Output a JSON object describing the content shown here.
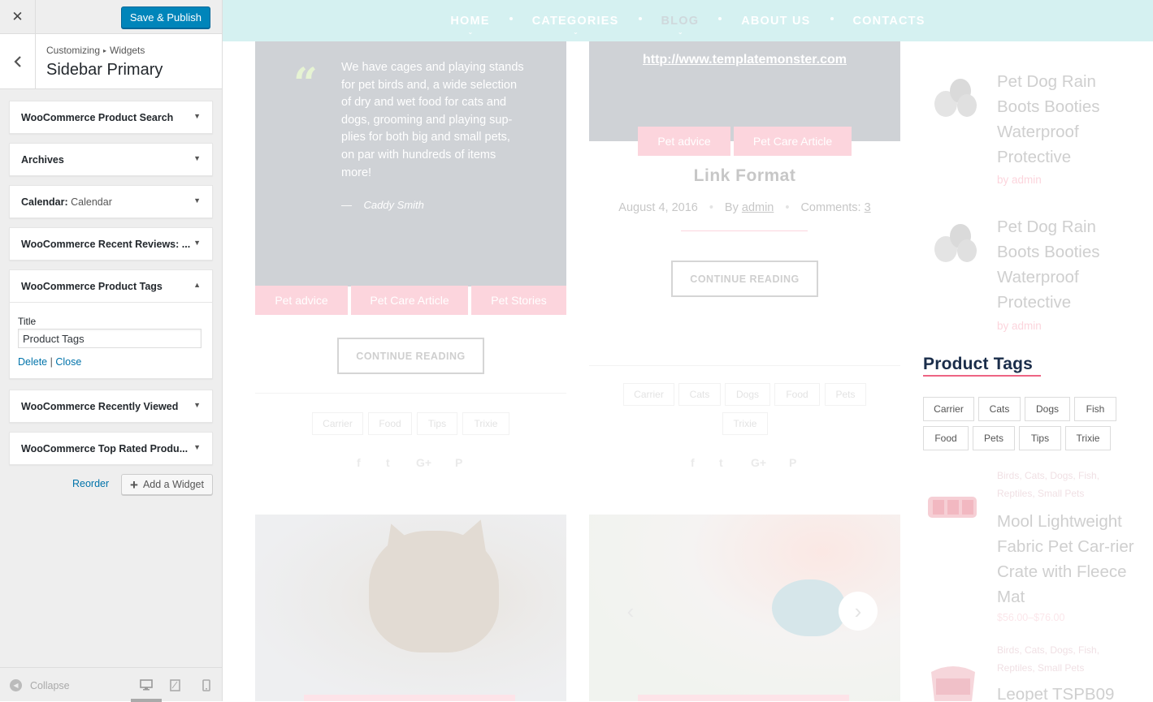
{
  "customizer": {
    "close_icon": "close-icon",
    "save_label": "Save & Publish",
    "breadcrumb": {
      "root": "Customizing",
      "section": "Widgets"
    },
    "section_title": "Sidebar Primary",
    "widgets": [
      {
        "title": "WooCommerce Product Search",
        "subtitle": "",
        "expanded": false
      },
      {
        "title": "Archives",
        "subtitle": "",
        "expanded": false
      },
      {
        "title": "Calendar:",
        "subtitle": "Calendar",
        "expanded": false
      },
      {
        "title": "WooCommerce Recent Reviews: ...",
        "subtitle": "",
        "expanded": false
      },
      {
        "title": "WooCommerce Product Tags",
        "subtitle": "",
        "expanded": true
      },
      {
        "title": "WooCommerce Recently Viewed",
        "subtitle": "",
        "expanded": false
      },
      {
        "title": "WooCommerce Top Rated Produ...",
        "subtitle": "",
        "expanded": false
      }
    ],
    "open_widget": {
      "field_label": "Title",
      "field_value": "Product Tags",
      "delete_label": "Delete",
      "separator": "|",
      "close_label": "Close"
    },
    "reorder_label": "Reorder",
    "add_widget_label": "Add a Widget",
    "collapse_label": "Collapse"
  },
  "site": {
    "nav": [
      {
        "label": "HOME",
        "active": false,
        "has_sub": true
      },
      {
        "label": "CATEGORIES",
        "active": false,
        "has_sub": true
      },
      {
        "label": "BLOG",
        "active": true,
        "has_sub": true
      },
      {
        "label": "ABOUT US",
        "active": false,
        "has_sub": false
      },
      {
        "label": "CONTACTS",
        "active": false,
        "has_sub": false
      }
    ],
    "quote_post": {
      "quote": "We have cages and playing stands for pet birds and, a wide selection of dry and wet food for cats and dogs, grooming and playing sup-plies for both big and small pets, on par with hundreds of items more!",
      "author_dash": "—",
      "author": "Caddy Smith",
      "categories": [
        "Pet advice",
        "Pet Care Article",
        "Pet Stories"
      ],
      "button": "CONTINUE READING",
      "tags": [
        "Carrier",
        "Food",
        "Tips",
        "Trixie"
      ]
    },
    "link_post": {
      "url": "http://www.templatemonster.com",
      "categories": [
        "Pet advice",
        "Pet Care Article"
      ],
      "title": "Link Format",
      "date": "August 4, 2016",
      "by_prefix": "By",
      "author": "admin",
      "comments_prefix": "Comments:",
      "comments": "3",
      "button": "CONTINUE READING",
      "tags": [
        "Carrier",
        "Cats",
        "Dogs",
        "Food",
        "Pets",
        "Trixie"
      ]
    },
    "sidebar": {
      "products_top": [
        {
          "title": "Pet Dog Rain Boots Booties Waterproof Protective",
          "author": "by admin"
        },
        {
          "title": "Pet Dog Rain Boots Booties Waterproof Protective",
          "author": "by admin"
        }
      ],
      "tags_title": "Product Tags",
      "tags": [
        "Carrier",
        "Cats",
        "Dogs",
        "Fish",
        "Food",
        "Pets",
        "Tips",
        "Trixie"
      ],
      "products_bottom": [
        {
          "cats": "Birds, Cats, Dogs, Fish, Reptiles, Small Pets",
          "title": "Mool Lightweight Fabric Pet Car-rier Crate with Fleece Mat",
          "price": "$56.00–$76.00"
        },
        {
          "cats": "Birds, Cats, Dogs, Fish, Reptiles, Small Pets",
          "title": "Leopet TSPB09",
          "price": ""
        }
      ]
    }
  }
}
